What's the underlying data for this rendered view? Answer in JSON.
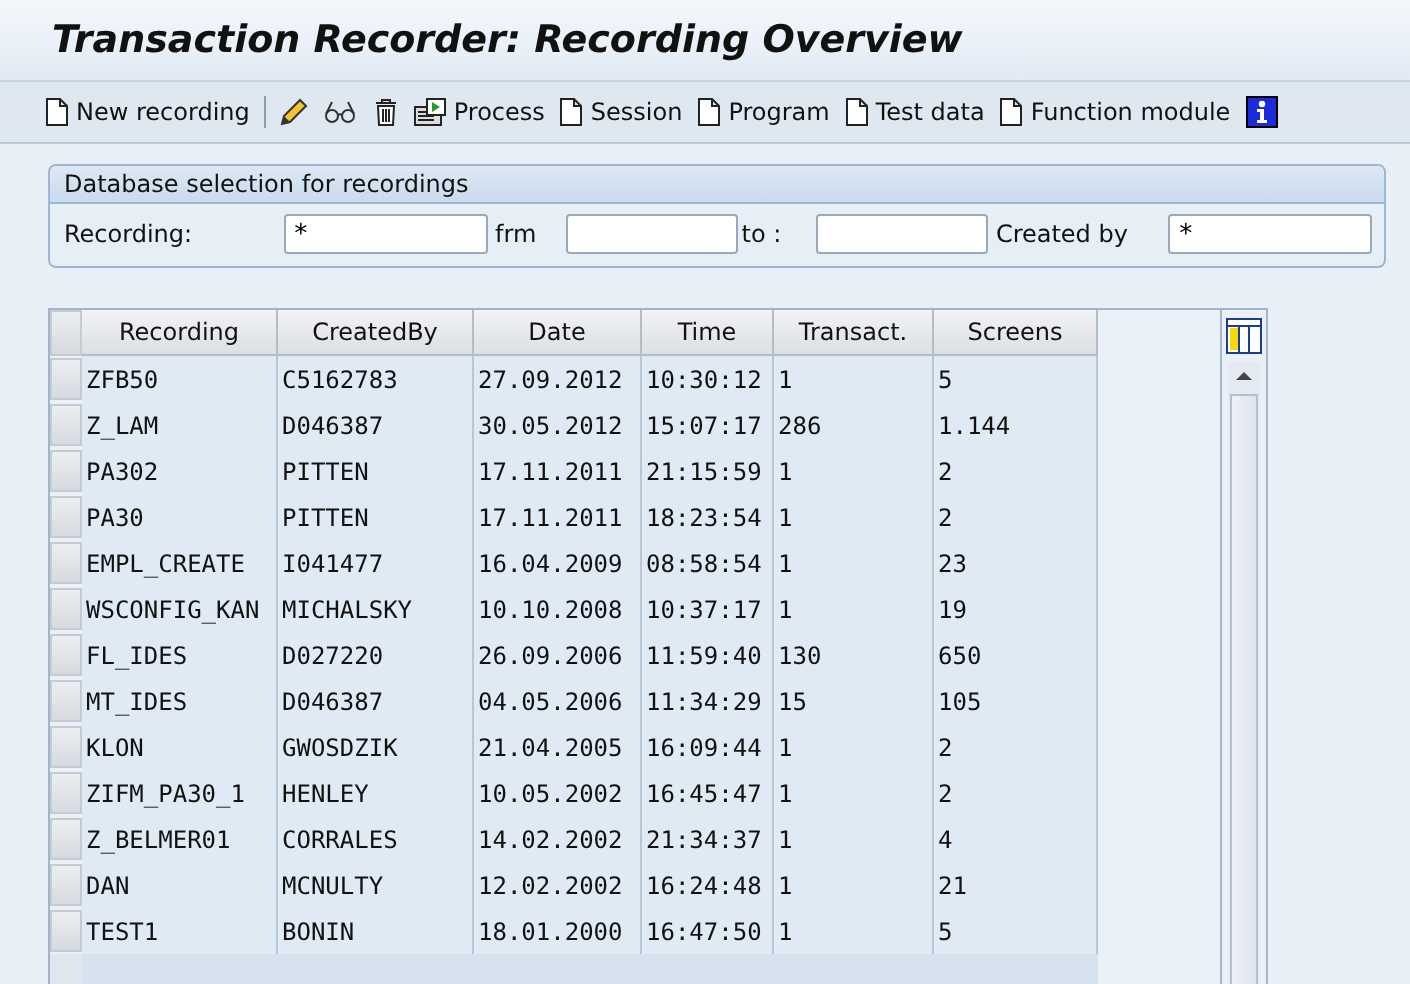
{
  "window": {
    "title": "Transaction Recorder: Recording Overview"
  },
  "toolbar": [
    {
      "kind": "document",
      "label": "New recording"
    },
    {
      "kind": "separator"
    },
    {
      "kind": "pencil"
    },
    {
      "kind": "glasses"
    },
    {
      "kind": "trash"
    },
    {
      "kind": "process",
      "label": "Process"
    },
    {
      "kind": "document",
      "label": "Session"
    },
    {
      "kind": "document",
      "label": "Program"
    },
    {
      "kind": "document",
      "label": "Test data"
    },
    {
      "kind": "document",
      "label": "Function module"
    },
    {
      "kind": "info"
    }
  ],
  "selection": {
    "title": "Database selection for recordings",
    "fields": [
      {
        "label": "Recording:",
        "value": "*"
      },
      {
        "label": "frm"
      },
      {
        "label": "to :"
      },
      {
        "label": "Created by",
        "value": "*"
      }
    ]
  },
  "table": {
    "columns": [
      "Recording",
      "CreatedBy",
      "Date",
      "Time",
      "Transact.",
      "Screens"
    ],
    "rows": [
      [
        "ZFB50",
        "C5162783",
        "27.09.2012",
        "10:30:12",
        "1",
        "5"
      ],
      [
        "Z_LAM",
        "D046387",
        "30.05.2012",
        "15:07:17",
        "286",
        "1.144"
      ],
      [
        "PA302",
        "PITTEN",
        "17.11.2011",
        "21:15:59",
        "1",
        "2"
      ],
      [
        "PA30",
        "PITTEN",
        "17.11.2011",
        "18:23:54",
        "1",
        "2"
      ],
      [
        "EMPL_CREATE",
        "I041477",
        "16.04.2009",
        "08:58:54",
        "1",
        "23"
      ],
      [
        "WSCONFIG_KAN",
        "MICHALSKY",
        "10.10.2008",
        "10:37:17",
        "1",
        "19"
      ],
      [
        "FL_IDES",
        "D027220",
        "26.09.2006",
        "11:59:40",
        "130",
        "650"
      ],
      [
        "MT_IDES",
        "D046387",
        "04.05.2006",
        "11:34:29",
        "15",
        "105"
      ],
      [
        "KLON",
        "GWOSDZIK",
        "21.04.2005",
        "16:09:44",
        "1",
        "2"
      ],
      [
        "ZIFM_PA30_1",
        "HENLEY",
        "10.05.2002",
        "16:45:47",
        "1",
        "2"
      ],
      [
        "Z_BELMER01",
        "CORRALES",
        "14.02.2002",
        "21:34:37",
        "1",
        "4"
      ],
      [
        "DAN",
        "MCNULTY",
        "12.02.2002",
        "16:24:48",
        "1",
        "21"
      ],
      [
        "TEST1",
        "BONIN",
        "18.01.2000",
        "16:47:50",
        "1",
        "5"
      ]
    ]
  }
}
